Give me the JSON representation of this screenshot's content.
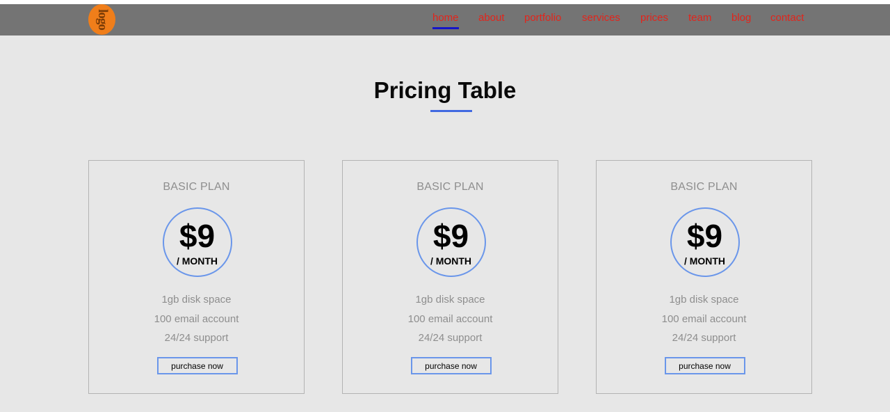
{
  "header": {
    "logo_text": "logo",
    "nav": [
      {
        "label": "home",
        "active": true
      },
      {
        "label": "about"
      },
      {
        "label": "portfolio"
      },
      {
        "label": "services"
      },
      {
        "label": "prices"
      },
      {
        "label": "team"
      },
      {
        "label": "blog"
      },
      {
        "label": "contact"
      }
    ]
  },
  "section": {
    "title": "Pricing Table"
  },
  "plans": [
    {
      "name": "BASIC PLAN",
      "price": "$9",
      "period": "/ MONTH",
      "features": [
        "1gb disk space",
        "100 email account",
        "24/24 support"
      ],
      "button": "purchase now"
    },
    {
      "name": "BASIC PLAN",
      "price": "$9",
      "period": "/ MONTH",
      "features": [
        "1gb disk space",
        "100 email account",
        "24/24 support"
      ],
      "button": "purchase now"
    },
    {
      "name": "BASIC PLAN",
      "price": "$9",
      "period": "/ MONTH",
      "features": [
        "1gb disk space",
        "100 email account",
        "24/24 support"
      ],
      "button": "purchase now"
    }
  ],
  "colors": {
    "navbar": "#747474",
    "nav_link": "#e3241b",
    "nav_active_underline": "#1515c8",
    "accent": "#4169e1",
    "circle_border": "#6a96ea",
    "logo": "#f07e1a",
    "background": "#e7e7e7"
  }
}
